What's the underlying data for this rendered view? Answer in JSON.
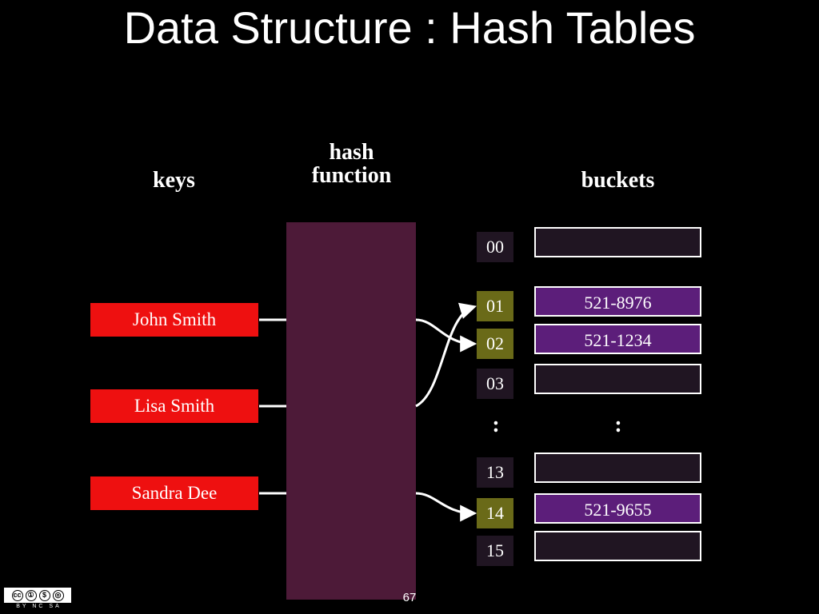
{
  "title": "Data Structure : Hash Tables",
  "columns": {
    "keys": "keys",
    "hash_line1": "hash",
    "hash_line2": "function",
    "buckets": "buckets"
  },
  "keys": [
    {
      "label": "John Smith"
    },
    {
      "label": "Lisa Smith"
    },
    {
      "label": "Sandra Dee"
    }
  ],
  "indices": [
    {
      "label": "00",
      "tone": "dark"
    },
    {
      "label": "01",
      "tone": "olive"
    },
    {
      "label": "02",
      "tone": "olive"
    },
    {
      "label": "03",
      "tone": "dark"
    },
    {
      "label": "13",
      "tone": "dark"
    },
    {
      "label": "14",
      "tone": "olive"
    },
    {
      "label": "15",
      "tone": "dark"
    }
  ],
  "buckets": [
    {
      "label": "",
      "tone": "dark"
    },
    {
      "label": "521-8976",
      "tone": "purple"
    },
    {
      "label": "521-1234",
      "tone": "purple"
    },
    {
      "label": "",
      "tone": "dark"
    },
    {
      "label": "",
      "tone": "dark"
    },
    {
      "label": "521-9655",
      "tone": "purple"
    },
    {
      "label": "",
      "tone": "dark"
    }
  ],
  "vdots_idx": ":",
  "vdots_bucket": ":",
  "page_number": "67",
  "cc": {
    "c1": "cc",
    "c2": "①",
    "c3": "$",
    "c4": "◎",
    "text": "BY NC SA"
  }
}
